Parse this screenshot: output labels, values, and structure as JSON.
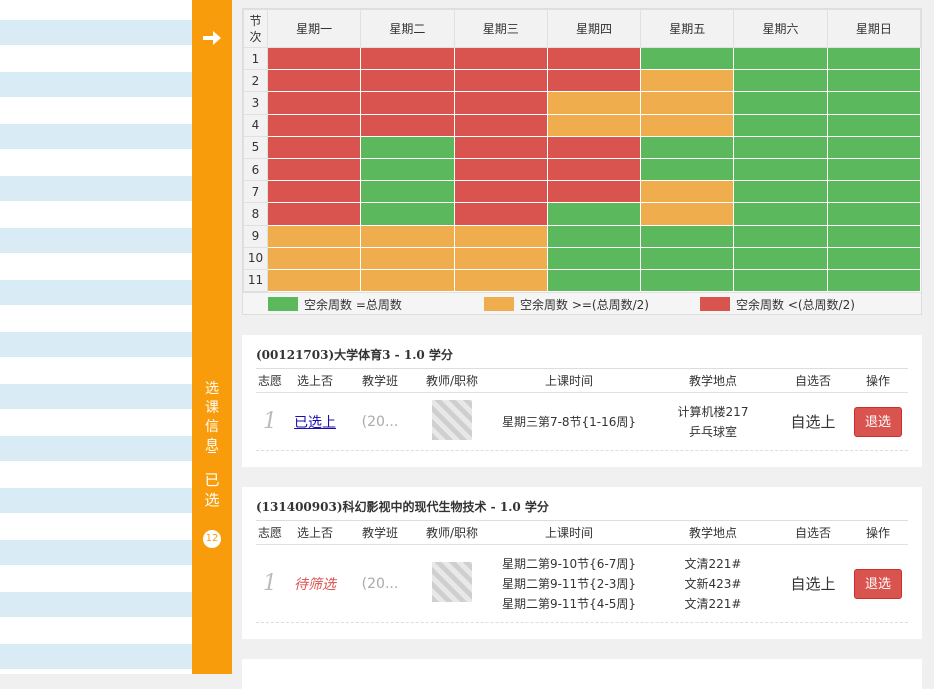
{
  "sidebar": {
    "vertical_label_1": [
      "选",
      "课",
      "信",
      "息"
    ],
    "vertical_label_2": [
      "已",
      "选"
    ],
    "selected_count": "12"
  },
  "timetable": {
    "header_jc": [
      "节",
      "次"
    ],
    "days": [
      "星期一",
      "星期二",
      "星期三",
      "星期四",
      "星期五",
      "星期六",
      "星期日"
    ],
    "rows": [
      {
        "n": "1",
        "cells": [
          "r",
          "r",
          "r",
          "r",
          "g",
          "g",
          "g"
        ]
      },
      {
        "n": "2",
        "cells": [
          "r",
          "r",
          "r",
          "r",
          "o",
          "g",
          "g"
        ]
      },
      {
        "n": "3",
        "cells": [
          "r",
          "r",
          "r",
          "o",
          "o",
          "g",
          "g"
        ]
      },
      {
        "n": "4",
        "cells": [
          "r",
          "r",
          "r",
          "o",
          "o",
          "g",
          "g"
        ]
      },
      {
        "n": "5",
        "cells": [
          "r",
          "g",
          "r",
          "r",
          "g",
          "g",
          "g"
        ]
      },
      {
        "n": "6",
        "cells": [
          "r",
          "g",
          "r",
          "r",
          "g",
          "g",
          "g"
        ]
      },
      {
        "n": "7",
        "cells": [
          "r",
          "g",
          "r",
          "r",
          "o",
          "g",
          "g"
        ]
      },
      {
        "n": "8",
        "cells": [
          "r",
          "g",
          "r",
          "g",
          "o",
          "g",
          "g"
        ]
      },
      {
        "n": "9",
        "cells": [
          "o",
          "o",
          "o",
          "g",
          "g",
          "g",
          "g"
        ]
      },
      {
        "n": "10",
        "cells": [
          "o",
          "o",
          "o",
          "g",
          "g",
          "g",
          "g"
        ]
      },
      {
        "n": "11",
        "cells": [
          "o",
          "o",
          "o",
          "g",
          "g",
          "g",
          "g"
        ]
      }
    ],
    "legend": [
      {
        "color": "#5cb85c",
        "label": "空余周数 =总周数"
      },
      {
        "color": "#f0ad4e",
        "label": "空余周数 >=(总周数/2)"
      },
      {
        "color": "#d9534f",
        "label": "空余周数 <(总周数/2)"
      }
    ],
    "colors": {
      "g": "#5cb85c",
      "o": "#f0ad4e",
      "r": "#d9534f"
    }
  },
  "table_headers": [
    "志愿",
    "选上否",
    "教学班",
    "教师/职称",
    "上课时间",
    "教学地点",
    "自选否",
    "操作"
  ],
  "courses": [
    {
      "title": "(00121703)大学体育3 - 1.0 学分",
      "priority": "1",
      "status": "已选上",
      "class": "(20...",
      "times": [
        "星期三第7-8节{1-16周}"
      ],
      "locations": [
        "计算机楼217",
        "乒乓球室"
      ],
      "self_select": "自选上",
      "action": "退选"
    },
    {
      "title": "(131400903)科幻影视中的现代生物技术 - 1.0 学分",
      "priority": "1",
      "status": "待筛选",
      "class": "(20...",
      "times": [
        "星期二第9-10节{6-7周}",
        "星期二第9-11节{2-3周}",
        "星期二第9-11节{4-5周}"
      ],
      "locations": [
        "文清221#",
        "文新423#",
        "文清221#"
      ],
      "self_select": "自选上",
      "action": "退选"
    }
  ]
}
